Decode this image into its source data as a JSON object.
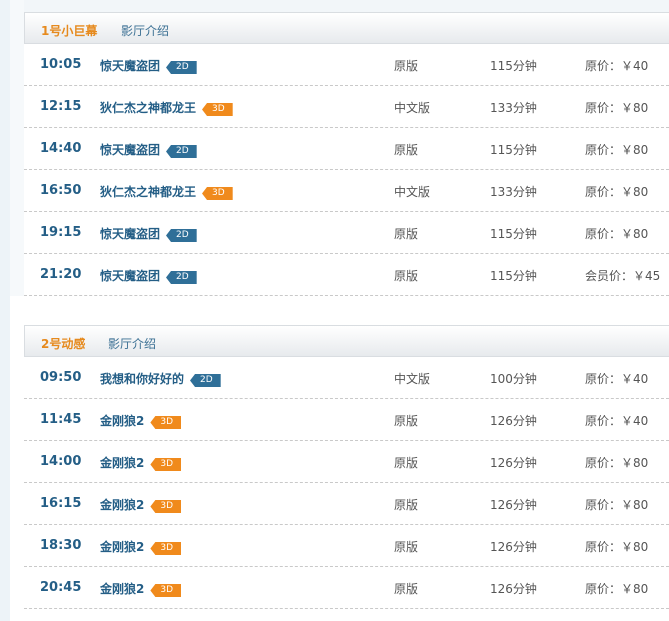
{
  "halls": [
    {
      "name": "1号小巨幕",
      "intro_label": "影厅介绍",
      "showings": [
        {
          "time": "10:05",
          "movie": "惊天魔盗团",
          "format": "2D",
          "version": "原版",
          "duration": "115分钟",
          "price": "原价：￥40"
        },
        {
          "time": "12:15",
          "movie": "狄仁杰之神都龙王",
          "format": "3D",
          "version": "中文版",
          "duration": "133分钟",
          "price": "原价：￥80"
        },
        {
          "time": "14:40",
          "movie": "惊天魔盗团",
          "format": "2D",
          "version": "原版",
          "duration": "115分钟",
          "price": "原价：￥80"
        },
        {
          "time": "16:50",
          "movie": "狄仁杰之神都龙王",
          "format": "3D",
          "version": "中文版",
          "duration": "133分钟",
          "price": "原价：￥80"
        },
        {
          "time": "19:15",
          "movie": "惊天魔盗团",
          "format": "2D",
          "version": "原版",
          "duration": "115分钟",
          "price": "原价：￥80"
        },
        {
          "time": "21:20",
          "movie": "惊天魔盗团",
          "format": "2D",
          "version": "原版",
          "duration": "115分钟",
          "price": "会员价：￥45"
        }
      ]
    },
    {
      "name": "2号动感",
      "intro_label": "影厅介绍",
      "showings": [
        {
          "time": "09:50",
          "movie": "我想和你好好的",
          "format": "2D",
          "version": "中文版",
          "duration": "100分钟",
          "price": "原价：￥40"
        },
        {
          "time": "11:45",
          "movie": "金刚狼2",
          "format": "3D",
          "version": "原版",
          "duration": "126分钟",
          "price": "原价：￥40"
        },
        {
          "time": "14:00",
          "movie": "金刚狼2",
          "format": "3D",
          "version": "原版",
          "duration": "126分钟",
          "price": "原价：￥80"
        },
        {
          "time": "16:15",
          "movie": "金刚狼2",
          "format": "3D",
          "version": "原版",
          "duration": "126分钟",
          "price": "原价：￥80"
        },
        {
          "time": "18:30",
          "movie": "金刚狼2",
          "format": "3D",
          "version": "原版",
          "duration": "126分钟",
          "price": "原价：￥80"
        },
        {
          "time": "20:45",
          "movie": "金刚狼2",
          "format": "3D",
          "version": "原版",
          "duration": "126分钟",
          "price": "原价：￥80"
        }
      ]
    }
  ],
  "colors": {
    "badge_2d": "#2f6f98",
    "badge_3d": "#f08a1c",
    "hall_name": "#e68a1e",
    "time_text": "#245e86"
  }
}
